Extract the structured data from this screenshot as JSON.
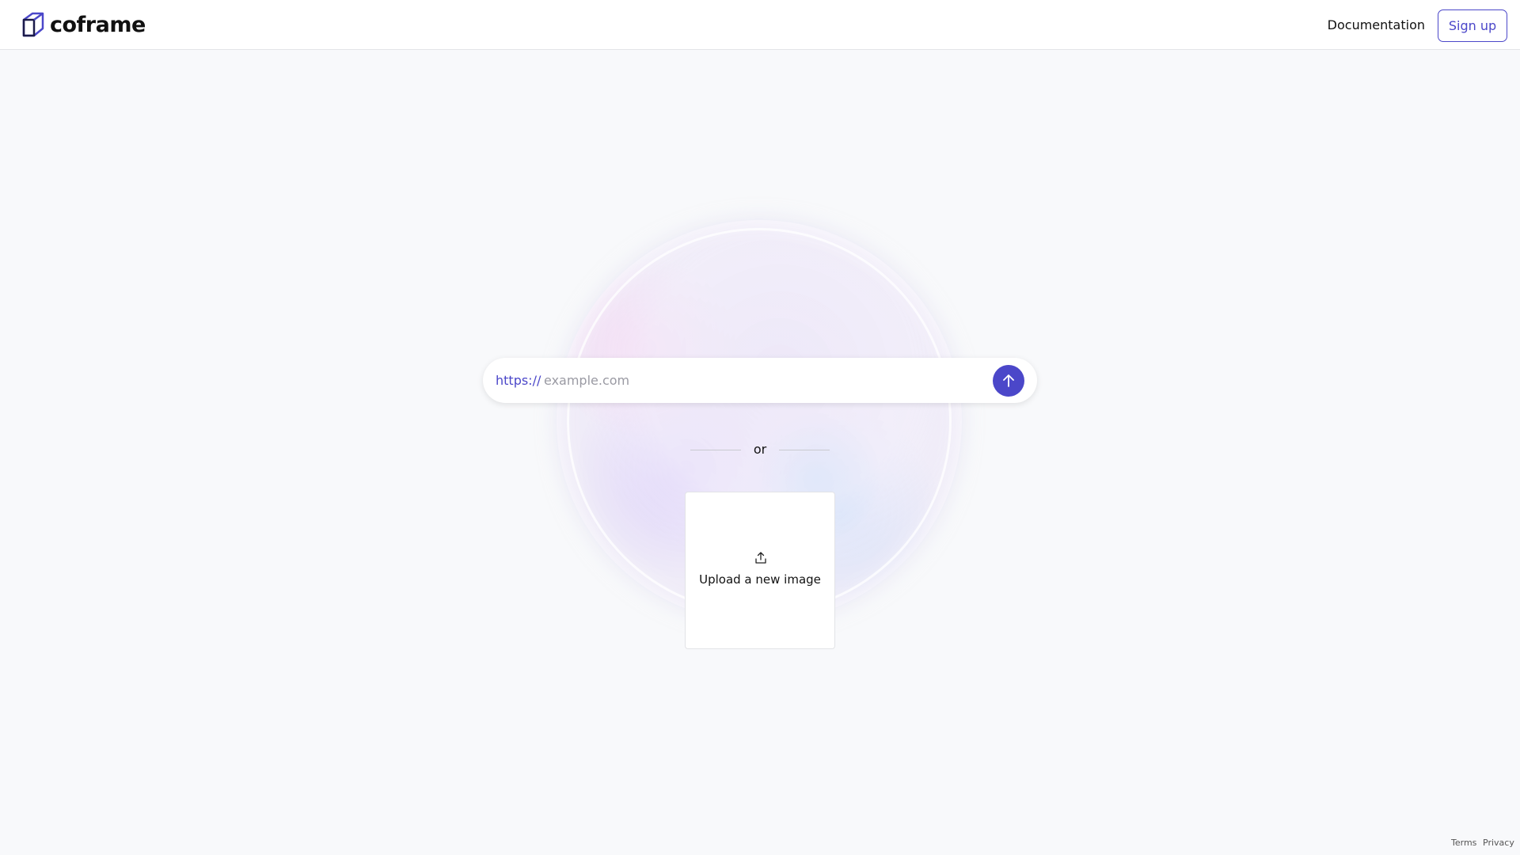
{
  "header": {
    "brand": "coframe",
    "documentation_label": "Documentation",
    "signup_label": "Sign up"
  },
  "url_form": {
    "prefix": "https://",
    "placeholder": "example.com",
    "value": "",
    "submit_icon": "arrow-up-icon"
  },
  "divider": {
    "text": "or"
  },
  "upload": {
    "icon": "upload-icon",
    "label": "Upload a new image"
  },
  "footer": {
    "terms_label": "Terms",
    "privacy_label": "Privacy"
  },
  "colors": {
    "accent": "#4b47c9",
    "background": "#f8f9fb",
    "header_bg": "#ffffff"
  }
}
